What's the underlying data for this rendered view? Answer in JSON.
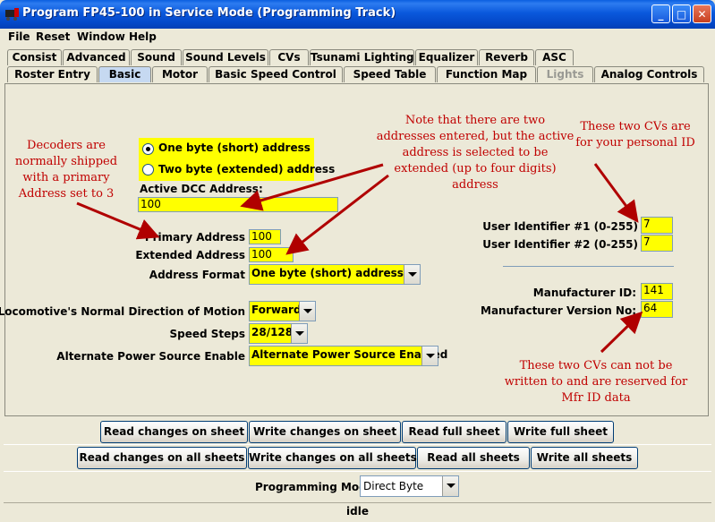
{
  "window": {
    "title": "Program FP45-100 in Service Mode (Programming Track)"
  },
  "menu": [
    "File",
    "Reset",
    "Window",
    "Help"
  ],
  "tabs_row1": [
    "Consist",
    "Advanced",
    "Sound",
    "Sound Levels",
    "CVs",
    "Tsunami Lighting",
    "Equalizer",
    "Reverb",
    "ASC"
  ],
  "tabs_row2": [
    "Roster Entry",
    "Basic",
    "Motor",
    "Basic Speed Control",
    "Speed Table",
    "Function Map",
    "Lights",
    "Analog Controls"
  ],
  "basic": {
    "radio_short": "One byte (short) address",
    "radio_long": "Two byte (extended) address",
    "active_dcc_label": "Active DCC Address:",
    "active_dcc_value": "100",
    "primary_label": "Primary Address",
    "primary_value": "100",
    "extended_label": "Extended Address",
    "extended_value": "100",
    "format_label": "Address Format",
    "format_value": "One byte (short) address",
    "direction_label": "Locomotive's Normal Direction of Motion",
    "direction_value": "Forward",
    "speed_steps_label": "Speed Steps",
    "speed_steps_value": "28/128",
    "alt_power_label": "Alternate Power Source Enable",
    "alt_power_value": "Alternate Power Source Enabled",
    "user_id1_label": "User Identifier #1 (0-255)",
    "user_id1_value": "7",
    "user_id2_label": "User Identifier #2 (0-255)",
    "user_id2_value": "7",
    "mfr_id_label": "Manufacturer ID:",
    "mfr_id_value": "141",
    "mfr_ver_label": "Manufacturer Version No:",
    "mfr_ver_value": "64"
  },
  "notes": {
    "decoders": [
      "Decoders are",
      "normally shipped",
      "with a primary",
      "Address set to 3"
    ],
    "two_addresses": [
      "Note that there are two",
      "addresses entered, but the active",
      "address is selected to be",
      "extended (up to four digits)",
      "address"
    ],
    "personal_id": [
      "These two CVs are",
      "for your personal ID"
    ],
    "reserved": [
      "These two CVs can not be",
      "written to and are reserved for",
      "Mfr ID data"
    ]
  },
  "buttons_sheet": [
    "Read changes on sheet",
    "Write changes on sheet",
    "Read full sheet",
    "Write full sheet"
  ],
  "buttons_all": [
    "Read changes on all sheets",
    "Write changes on all sheets",
    "Read all sheets",
    "Write all sheets"
  ],
  "programming_mode": {
    "label": "Programming Mode",
    "value": "Direct Byte"
  },
  "status": "idle",
  "colors": {
    "field": "#ffff00",
    "note": "#c00000",
    "arrow": "#b00000",
    "titlebar": "#0a58dc"
  }
}
